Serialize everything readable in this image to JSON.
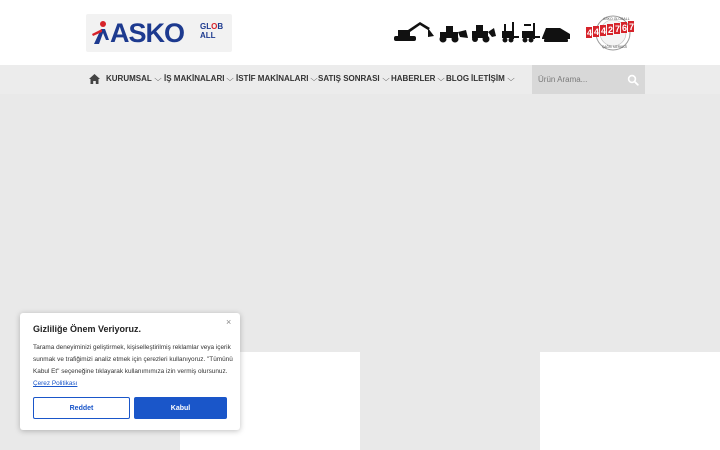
{
  "header": {
    "logo_text": "ASKO",
    "logo_suffix_top": "GL",
    "logo_suffix_o": "O",
    "logo_suffix_b": "B",
    "logo_suffix_bottom": "ALL",
    "badge_number": "4442767",
    "badge_top_text": "ASKO GLOBALL",
    "badge_bottom_text": "ÇAĞRI MERKEZİ"
  },
  "nav": {
    "home_icon": "home-icon",
    "items": [
      {
        "label": "KURUMSAL",
        "has_dropdown": true
      },
      {
        "label": "İŞ MAKİNALARI",
        "has_dropdown": true
      },
      {
        "label": "İSTİF MAKİNALARI",
        "has_dropdown": true
      },
      {
        "label": "SATIŞ SONRASI",
        "has_dropdown": true
      },
      {
        "label": "HABERLER",
        "has_dropdown": true
      },
      {
        "label": "BLOG",
        "has_dropdown": false
      },
      {
        "label": "İLETİŞİM",
        "has_dropdown": true
      }
    ],
    "chevron": "⌵"
  },
  "search": {
    "placeholder": "Ürün Arama...",
    "icon": "search-icon"
  },
  "cookie": {
    "close": "×",
    "title": "Gizliliğe Önem Veriyoruz.",
    "text": "Tarama deneyiminizi geliştirmek, kişiselleştirilmiş reklamlar veya içerik sunmak ve trafiğimizi analiz etmek için çerezleri kullanıyoruz. \"Tümünü Kabul Et\"  seçeneğine tıklayarak kullanımımıza izin vermiş olursunuz.",
    "link": "Çerez Politikası",
    "reject_label": "Reddet",
    "accept_label": "Kabul"
  },
  "colors": {
    "brand_blue": "#1d3a8f",
    "brand_red": "#d6232a",
    "button_blue": "#1a56c9",
    "nav_bg": "#ececec",
    "hero_bg": "#e9e9e9"
  }
}
